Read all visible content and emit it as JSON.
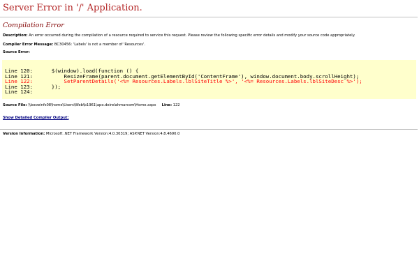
{
  "page": {
    "title": "Server Error in '/' Application.",
    "subtitle": "Compilation Error"
  },
  "description": {
    "label": "Description:",
    "text": "An error occurred during the compilation of a resource required to service this request. Please review the following specific error details and modify your source code appropriately."
  },
  "compiler_error": {
    "label": "Compiler Error Message:",
    "text": "BC30456: 'Labels' is not a member of 'Resources'."
  },
  "source_error": {
    "label": "Source Error:",
    "lines": [
      {
        "num": "Line 120:",
        "code": "    $(window).load(function () {",
        "error": false
      },
      {
        "num": "Line 121:",
        "code": "        ResizeFrame(parent.document.getElementById('ContentFrame'), window.document.body.scrollHeight);",
        "error": false
      },
      {
        "num": "Line 122:",
        "code": "        SetParentDetails('<%= Resources.Labels.lblSiteTitle %>', '<%= Resources.Labels.lblSiteDesc %>');",
        "error": true
      },
      {
        "num": "Line 123:",
        "code": "    });",
        "error": false
      },
      {
        "num": "Line 124:",
        "code": "",
        "error": false
      }
    ]
  },
  "source_file": {
    "label": "Source File:",
    "path": "\\\\boswinfs08\\home\\Users\\Web\\b1961\\apo.deirelahmarcom\\Home.aspx",
    "line_label": "Line:",
    "line_value": "122"
  },
  "compiler_output_link": "Show Detailed Compiler Output:",
  "version": {
    "label": "Version Information:",
    "text": "Microsoft .NET Framework Version:4.0.30319; ASP.NET Version:4.8.4690.0"
  },
  "colors": {
    "title": "#b22222",
    "subtitle": "#800000",
    "code_background": "#ffffcc",
    "error_line": "#ff0000",
    "link": "#000080"
  }
}
